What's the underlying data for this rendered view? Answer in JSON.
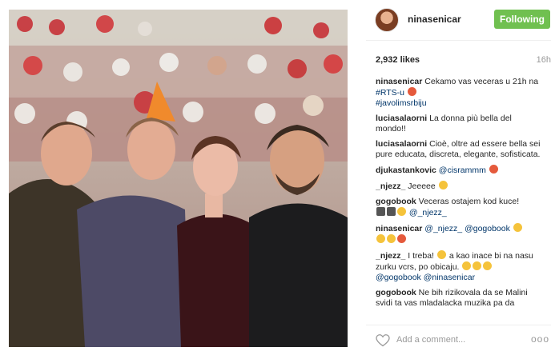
{
  "post": {
    "username": "ninasenicar",
    "follow_label": "Following",
    "likes": "2,932 likes",
    "time": "16h"
  },
  "comments": [
    {
      "user": "ninasenicar",
      "text": "Cekamo vas veceras u 21h na",
      "tags": [
        "#RTS-u",
        "#javolimsrbiju"
      ]
    },
    {
      "user": "luciasalaorni",
      "text": "La donna più bella del mondo!!"
    },
    {
      "user": "luciasalaorni",
      "text": "Cioè, oltre ad essere bella sei pure educata, discreta, elegante, sofisticata."
    },
    {
      "user": "djukastankovic",
      "mention": "@cisrammm"
    },
    {
      "user": "_njezz_",
      "text": "Jeeeee"
    },
    {
      "user": "gogobook",
      "text": "Veceras ostajem kod kuce!",
      "mention": "@_njezz_"
    },
    {
      "user": "ninasenicar",
      "mention": "@_njezz_ @gogobook"
    },
    {
      "user": "_njezz_",
      "text": "I treba!",
      "text2": "a kao inace bi na nasu zurku vcrs, po obicaju.",
      "mention": "@gogobook @ninasenicar"
    },
    {
      "user": "gogobook",
      "text": "Ne bih rizikovala da se Malini svidi ta vas mladalacka muzika pa da"
    }
  ],
  "add_comment": {
    "placeholder": "Add a comment..."
  },
  "icons": {
    "like": "heart-icon",
    "more": "more-options-icon",
    "emoji": "emoji-icon"
  },
  "colors": {
    "follow": "#70c050",
    "link": "#003569",
    "muted": "#999999"
  }
}
